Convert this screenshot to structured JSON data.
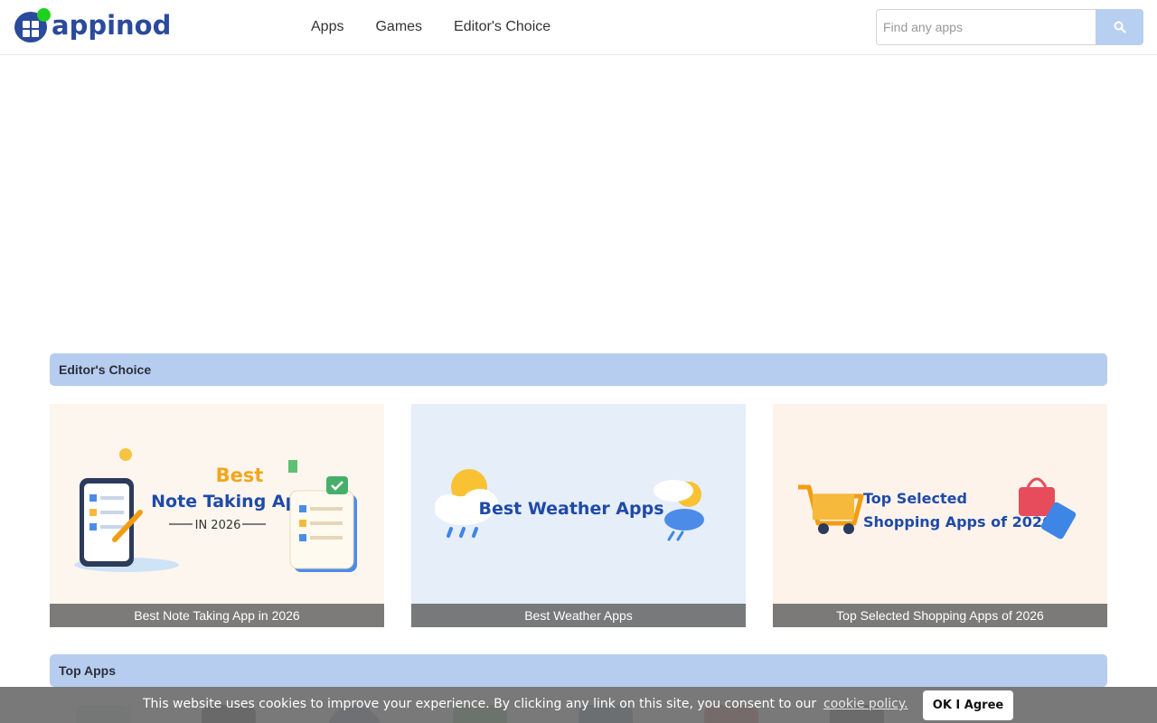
{
  "logo": {
    "text": "appinod"
  },
  "nav": {
    "items": [
      "Apps",
      "Games",
      "Editor's Choice"
    ]
  },
  "search": {
    "placeholder": "Find any apps",
    "button_icon": "search-icon"
  },
  "editors_choice": {
    "heading": "Editor's Choice",
    "cards": [
      {
        "caption": "Best Note Taking App in 2026",
        "banner_line1": "Best",
        "banner_line2": "Note Taking App",
        "banner_line3": "IN 2026"
      },
      {
        "caption": "Best Weather Apps",
        "banner_line1": "Best Weather Apps"
      },
      {
        "caption": "Top Selected Shopping Apps of 2026",
        "banner_line1": "Top Selected",
        "banner_line2": "Shopping Apps of 2026"
      }
    ]
  },
  "top_apps": {
    "heading": "Top Apps"
  },
  "cookie": {
    "message": "This website uses cookies to improve your experience. By clicking any link on this site, you consent to our",
    "link": "cookie policy.",
    "button": "OK I Agree"
  },
  "colors": {
    "brand": "#2b4a9b",
    "accent_green": "#1fd11f",
    "section_bar": "#b7cdef",
    "search_button": "#b7cff0"
  }
}
